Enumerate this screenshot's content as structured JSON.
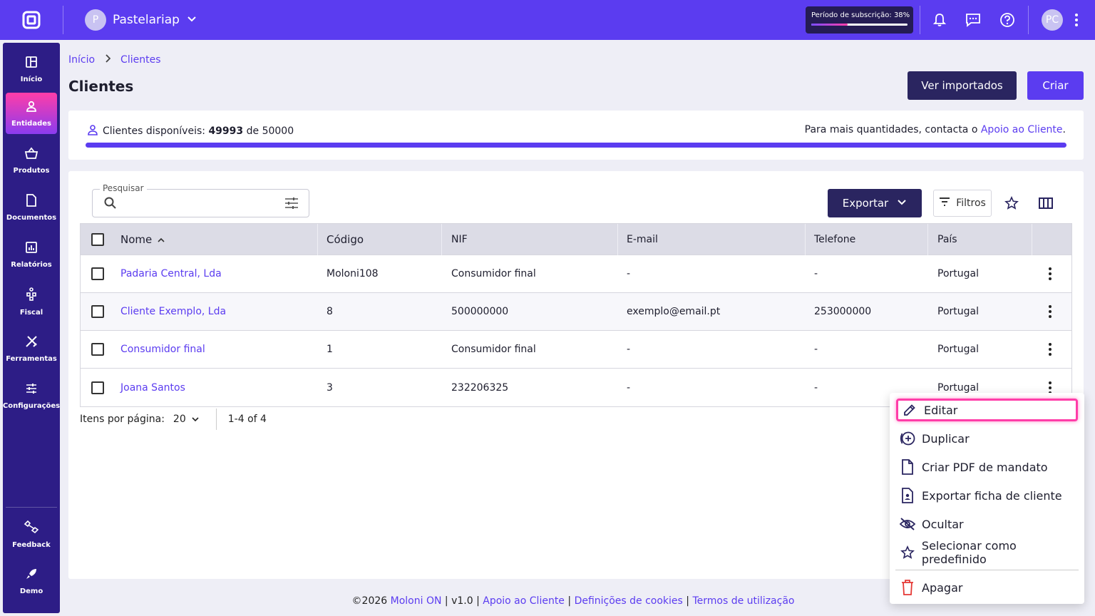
{
  "topbar": {
    "company_initial": "P",
    "company_name": "Pastelariap",
    "subscription_label": "Período de subscrição: 38%",
    "subscription_progress": 0.38,
    "user_initials": "PC",
    "icons": [
      "bell-icon",
      "chat-icon",
      "help-icon",
      "more-vert-icon"
    ]
  },
  "sidebar": {
    "items": [
      {
        "label": "Início",
        "icon": "dashboard-icon"
      },
      {
        "label": "Entidades",
        "icon": "person-icon",
        "active": true
      },
      {
        "label": "Produtos",
        "icon": "basket-icon"
      },
      {
        "label": "Documentos",
        "icon": "document-icon"
      },
      {
        "label": "Relatórios",
        "icon": "chart-icon"
      },
      {
        "label": "Fiscal",
        "icon": "fiscal-icon"
      },
      {
        "label": "Ferramentas",
        "icon": "tools-icon"
      },
      {
        "label": "Configurações",
        "icon": "sliders-icon"
      }
    ],
    "bottom": [
      {
        "label": "Feedback",
        "icon": "feedback-icon"
      },
      {
        "label": "Demo",
        "icon": "rocket-icon"
      }
    ]
  },
  "breadcrumb": {
    "home": "Início",
    "current": "Clientes"
  },
  "page": {
    "title": "Clientes",
    "btn_imported": "Ver importados",
    "btn_create": "Criar"
  },
  "availability": {
    "label": "Clientes disponíveis:",
    "available": "49993",
    "of": "de",
    "total": "50000",
    "progress": 0.9999,
    "contact_text": "Para mais quantidades, contacta o",
    "contact_link": "Apoio ao Cliente",
    "contact_end": "."
  },
  "toolbar": {
    "search_label": "Pesquisar",
    "search_value": "",
    "export_label": "Exportar",
    "filters_label": "Filtros"
  },
  "table": {
    "columns": [
      "Nome",
      "Código",
      "NIF",
      "E-mail",
      "Telefone",
      "País"
    ],
    "rows": [
      {
        "name": "Padaria Central, Lda",
        "code": "Moloni108",
        "nif": "Consumidor final",
        "email": "-",
        "phone": "-",
        "country": "Portugal"
      },
      {
        "name": "Cliente Exemplo, Lda",
        "code": "8",
        "nif": "500000000",
        "email": "exemplo@email.pt",
        "phone": "253000000",
        "country": "Portugal"
      },
      {
        "name": "Consumidor final",
        "code": "1",
        "nif": "Consumidor final",
        "email": "-",
        "phone": "-",
        "country": "Portugal"
      },
      {
        "name": "Joana Santos",
        "code": "3",
        "nif": "232206325",
        "email": "-",
        "phone": "-",
        "country": "Portugal"
      }
    ]
  },
  "pager": {
    "label": "Itens por página:",
    "per_page": "20",
    "range": "1-4 of 4"
  },
  "context_menu": {
    "items": [
      {
        "label": "Editar",
        "icon": "pencil-icon"
      },
      {
        "label": "Duplicar",
        "icon": "duplicate-icon"
      },
      {
        "label": "Criar PDF de mandato",
        "icon": "file-icon"
      },
      {
        "label": "Exportar ficha de cliente",
        "icon": "contact-file-icon"
      },
      {
        "label": "Ocultar",
        "icon": "eye-off-icon"
      },
      {
        "label": "Selecionar como predefinido",
        "icon": "star-icon"
      },
      {
        "label": "Apagar",
        "icon": "trash-icon"
      }
    ]
  },
  "footer": {
    "copyright": "©2026",
    "brand": "Moloni ON",
    "version": "v1.0",
    "support": "Apoio ao Cliente",
    "cookies": "Definições de cookies",
    "terms": "Termos de utilização",
    "sep": "|"
  },
  "colors": {
    "primary": "#5b3cf0",
    "dark": "#2a2560",
    "sidebar": "#2d1d86",
    "highlight": "#ff3da8",
    "danger": "#e53935"
  }
}
